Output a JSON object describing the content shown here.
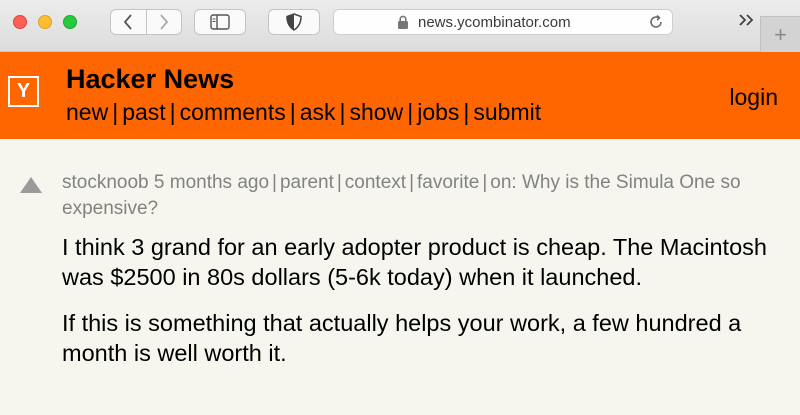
{
  "browser": {
    "url": "news.ycombinator.com",
    "icons": [
      "back-icon",
      "forward-icon",
      "sidebar-icon",
      "shield-icon",
      "lock-icon",
      "reload-icon",
      "chevrons-right-icon",
      "plus-icon"
    ],
    "new_tab_symbol": "+"
  },
  "header": {
    "logo": "Y",
    "title": "Hacker News",
    "nav": [
      "new",
      "past",
      "comments",
      "ask",
      "show",
      "jobs",
      "submit"
    ],
    "separator": "|",
    "login": "login",
    "bg_color": "#ff6600"
  },
  "comment": {
    "user": "stocknoob",
    "age": "5 months ago",
    "links": [
      "parent",
      "context",
      "favorite"
    ],
    "on_prefix": "on:",
    "story_title": "Why is the Simula One so expensive?",
    "paragraphs": [
      "I think 3 grand for an early adopter product is cheap. The Macintosh was $2500 in 80s dollars (5-6k today) when it launched.",
      "If this is something that actually helps your work, a few hundred a month is well worth it."
    ]
  }
}
